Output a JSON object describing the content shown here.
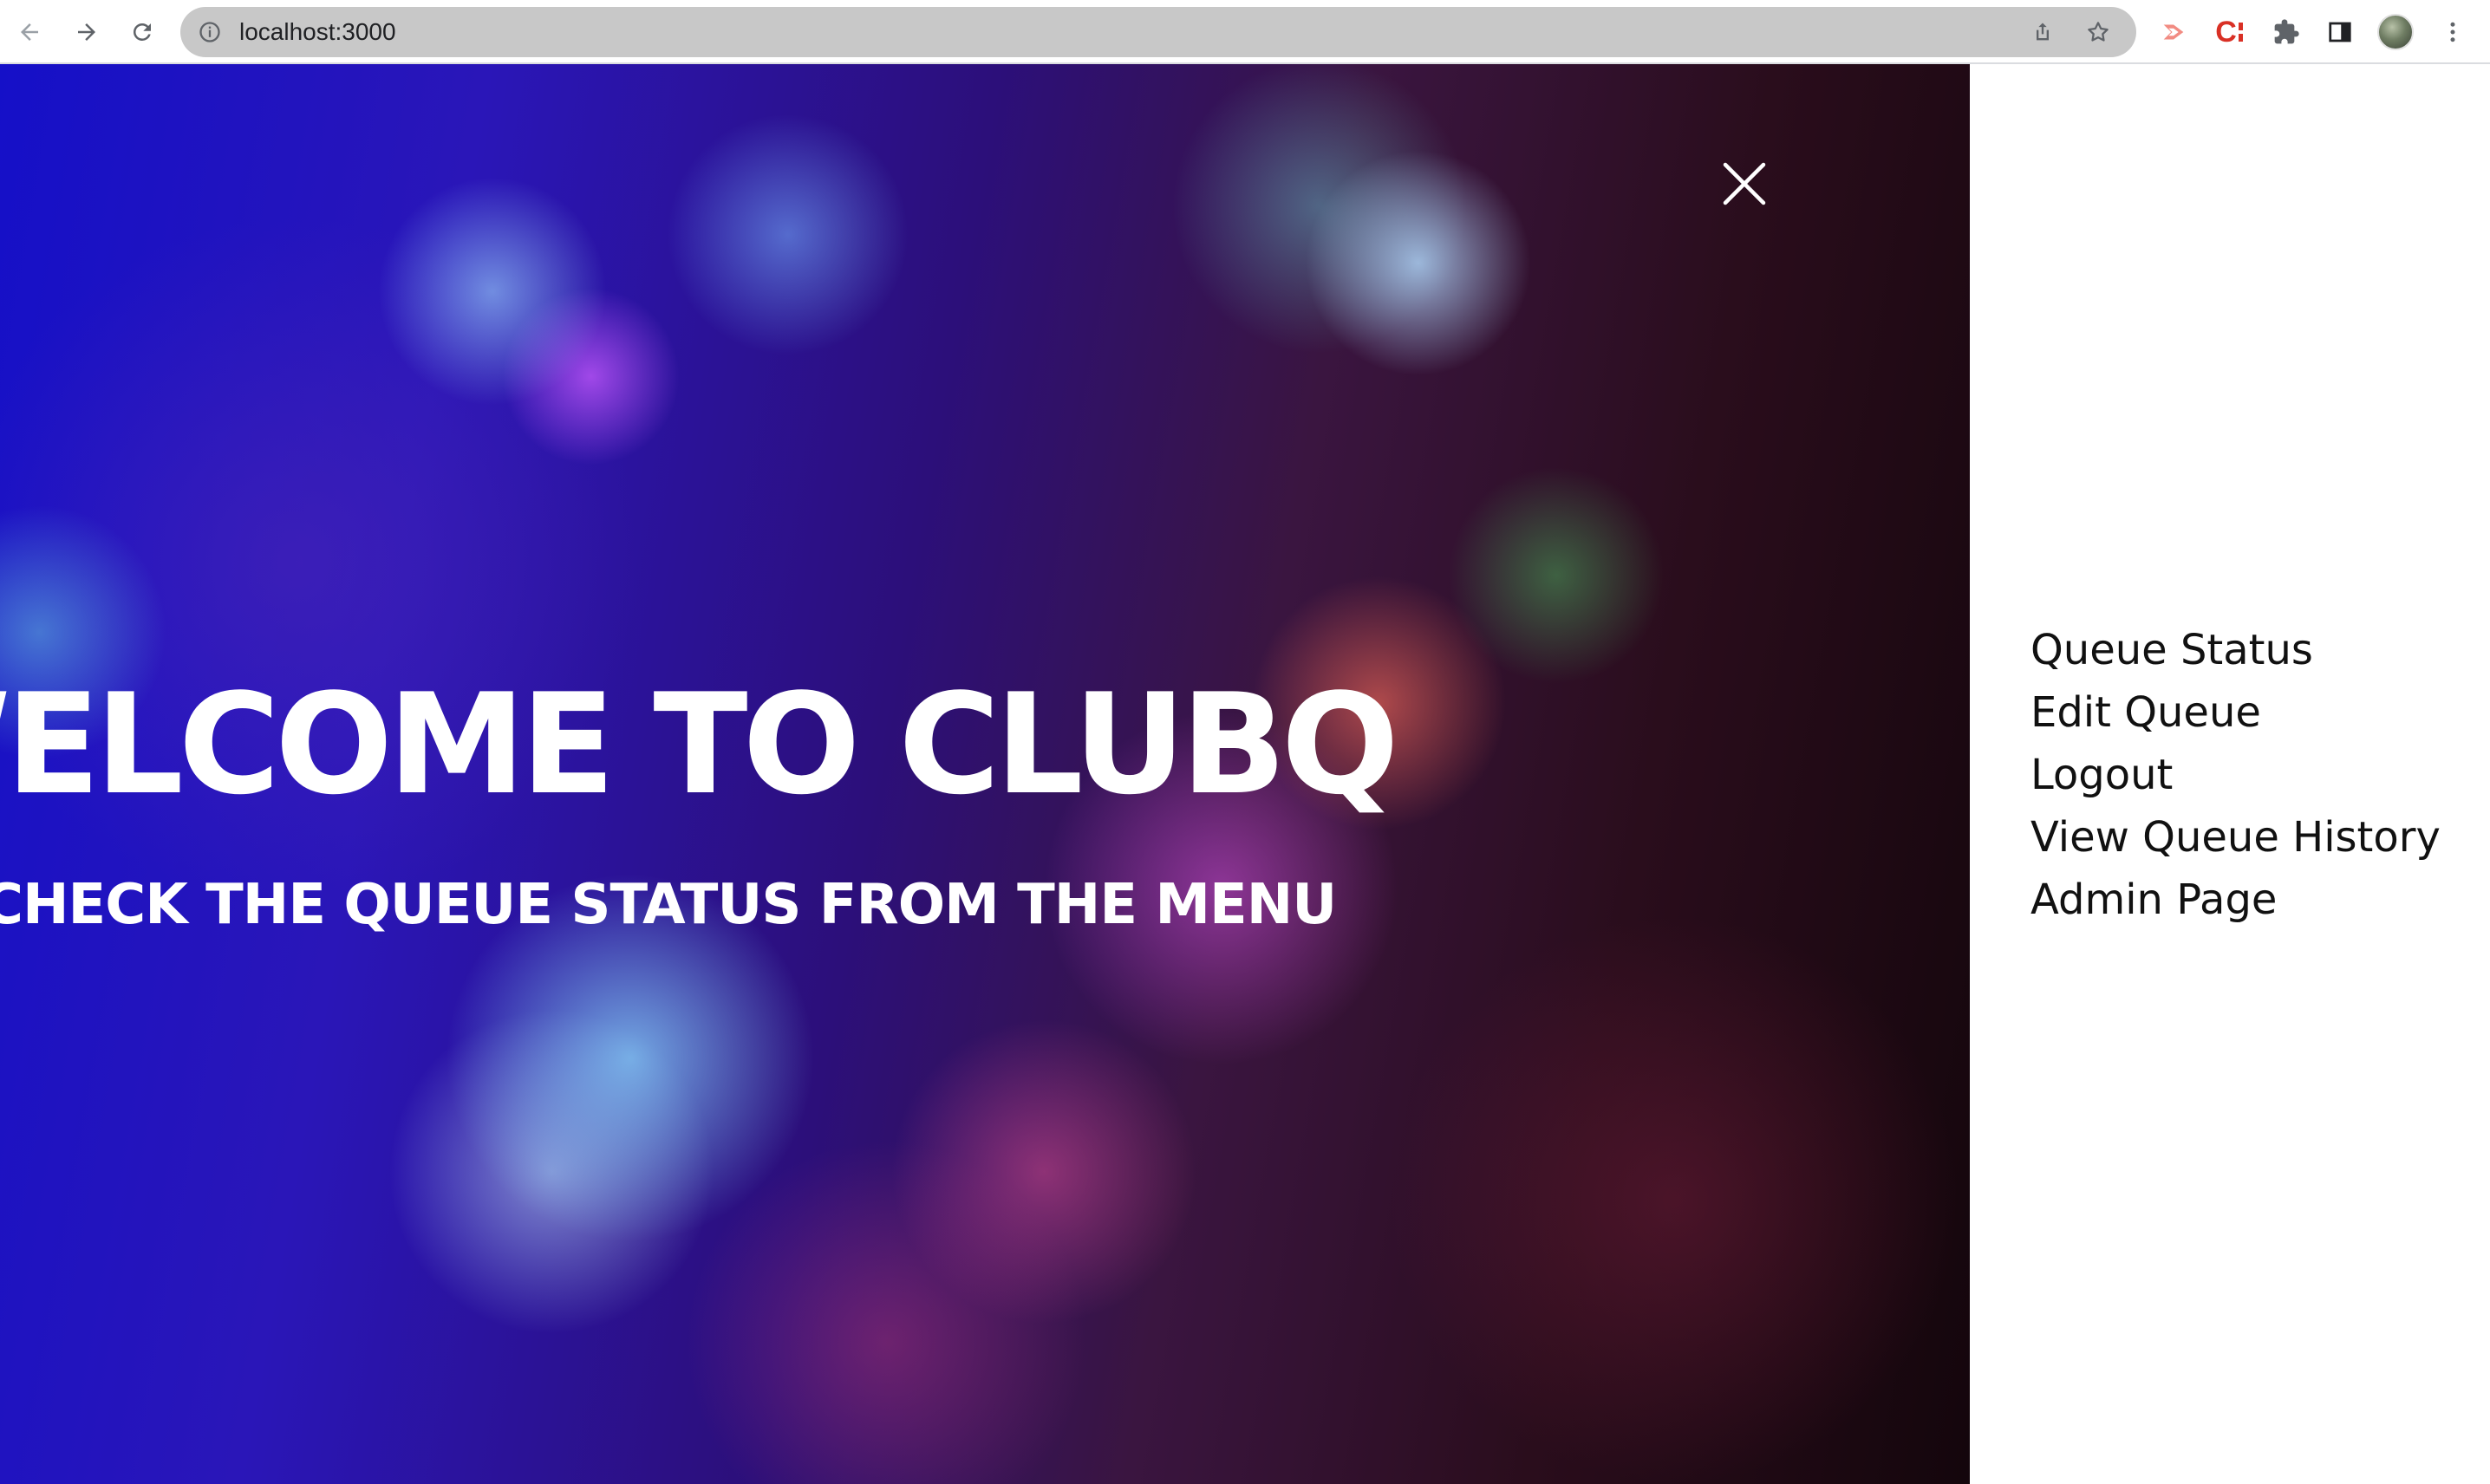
{
  "browser": {
    "url": "localhost:3000",
    "icons": {
      "back": "arrow-left-icon",
      "forward": "arrow-right-icon",
      "reload": "reload-icon",
      "site_info": "info-icon",
      "share": "share-icon",
      "bookmark": "star-icon",
      "extension_red": "red-arrow-extension-icon",
      "extension_c": "c-extension-icon",
      "extensions": "puzzle-icon",
      "side_panel": "side-panel-icon",
      "menu": "kebab-menu-icon"
    }
  },
  "hero": {
    "title": "WELCOME TO CLUBQ",
    "subtitle": "CHECK THE QUEUE STATUS FROM THE MENU",
    "close_icon": "close-icon"
  },
  "menu": {
    "items": [
      {
        "label": "Queue Status"
      },
      {
        "label": "Edit Queue"
      },
      {
        "label": "Logout"
      },
      {
        "label": "View Queue History"
      },
      {
        "label": "Admin Page"
      }
    ]
  },
  "colors": {
    "chrome_bg": "#ffffff",
    "omnibox_bg": "#c8c8c8",
    "menu_bg": "#ffffff",
    "menu_text": "#111111",
    "hero_text": "#ffffff"
  }
}
